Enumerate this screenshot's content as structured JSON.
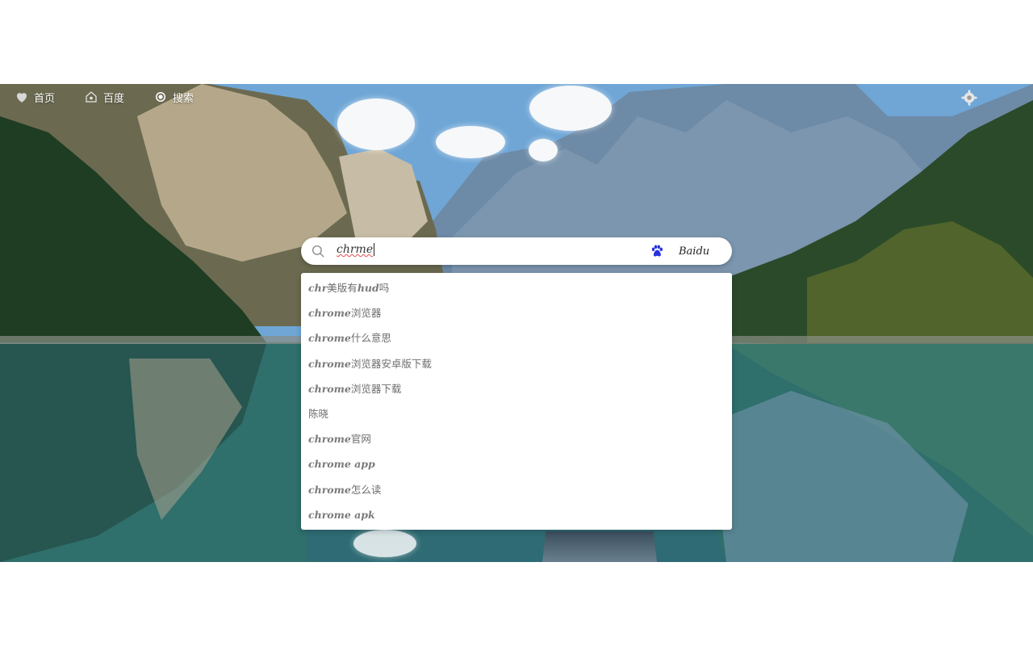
{
  "nav": {
    "items": [
      {
        "label": "首页",
        "icon": "heart-icon"
      },
      {
        "label": "百度",
        "icon": "baidu-house-icon"
      },
      {
        "label": "搜索",
        "icon": "radio-icon"
      }
    ],
    "settings_icon": "gear-icon"
  },
  "search": {
    "value": "chrme",
    "engine_label": "Baidu",
    "engine_icon": "baidu-paw-icon",
    "engine_icon_color": "#2932e1"
  },
  "suggestions": [
    {
      "en": "chr",
      "zh": "美版有",
      "en2": "hud",
      "zh2": "吗"
    },
    {
      "en": "chrome",
      "zh": "浏览器",
      "en2": "",
      "zh2": ""
    },
    {
      "en": "chrome",
      "zh": "什么意思",
      "en2": "",
      "zh2": ""
    },
    {
      "en": "chrome",
      "zh": "浏览器安卓版下载",
      "en2": "",
      "zh2": ""
    },
    {
      "en": "chrome",
      "zh": "浏览器下载",
      "en2": "",
      "zh2": ""
    },
    {
      "en": "",
      "zh": "陈晓",
      "en2": "",
      "zh2": ""
    },
    {
      "en": "chrome",
      "zh": "官网",
      "en2": "",
      "zh2": ""
    },
    {
      "en": "chrome app",
      "zh": "",
      "en2": "",
      "zh2": ""
    },
    {
      "en": "chrome",
      "zh": "怎么读",
      "en2": "",
      "zh2": ""
    },
    {
      "en": "chrome apk",
      "zh": "",
      "en2": "",
      "zh2": ""
    }
  ]
}
